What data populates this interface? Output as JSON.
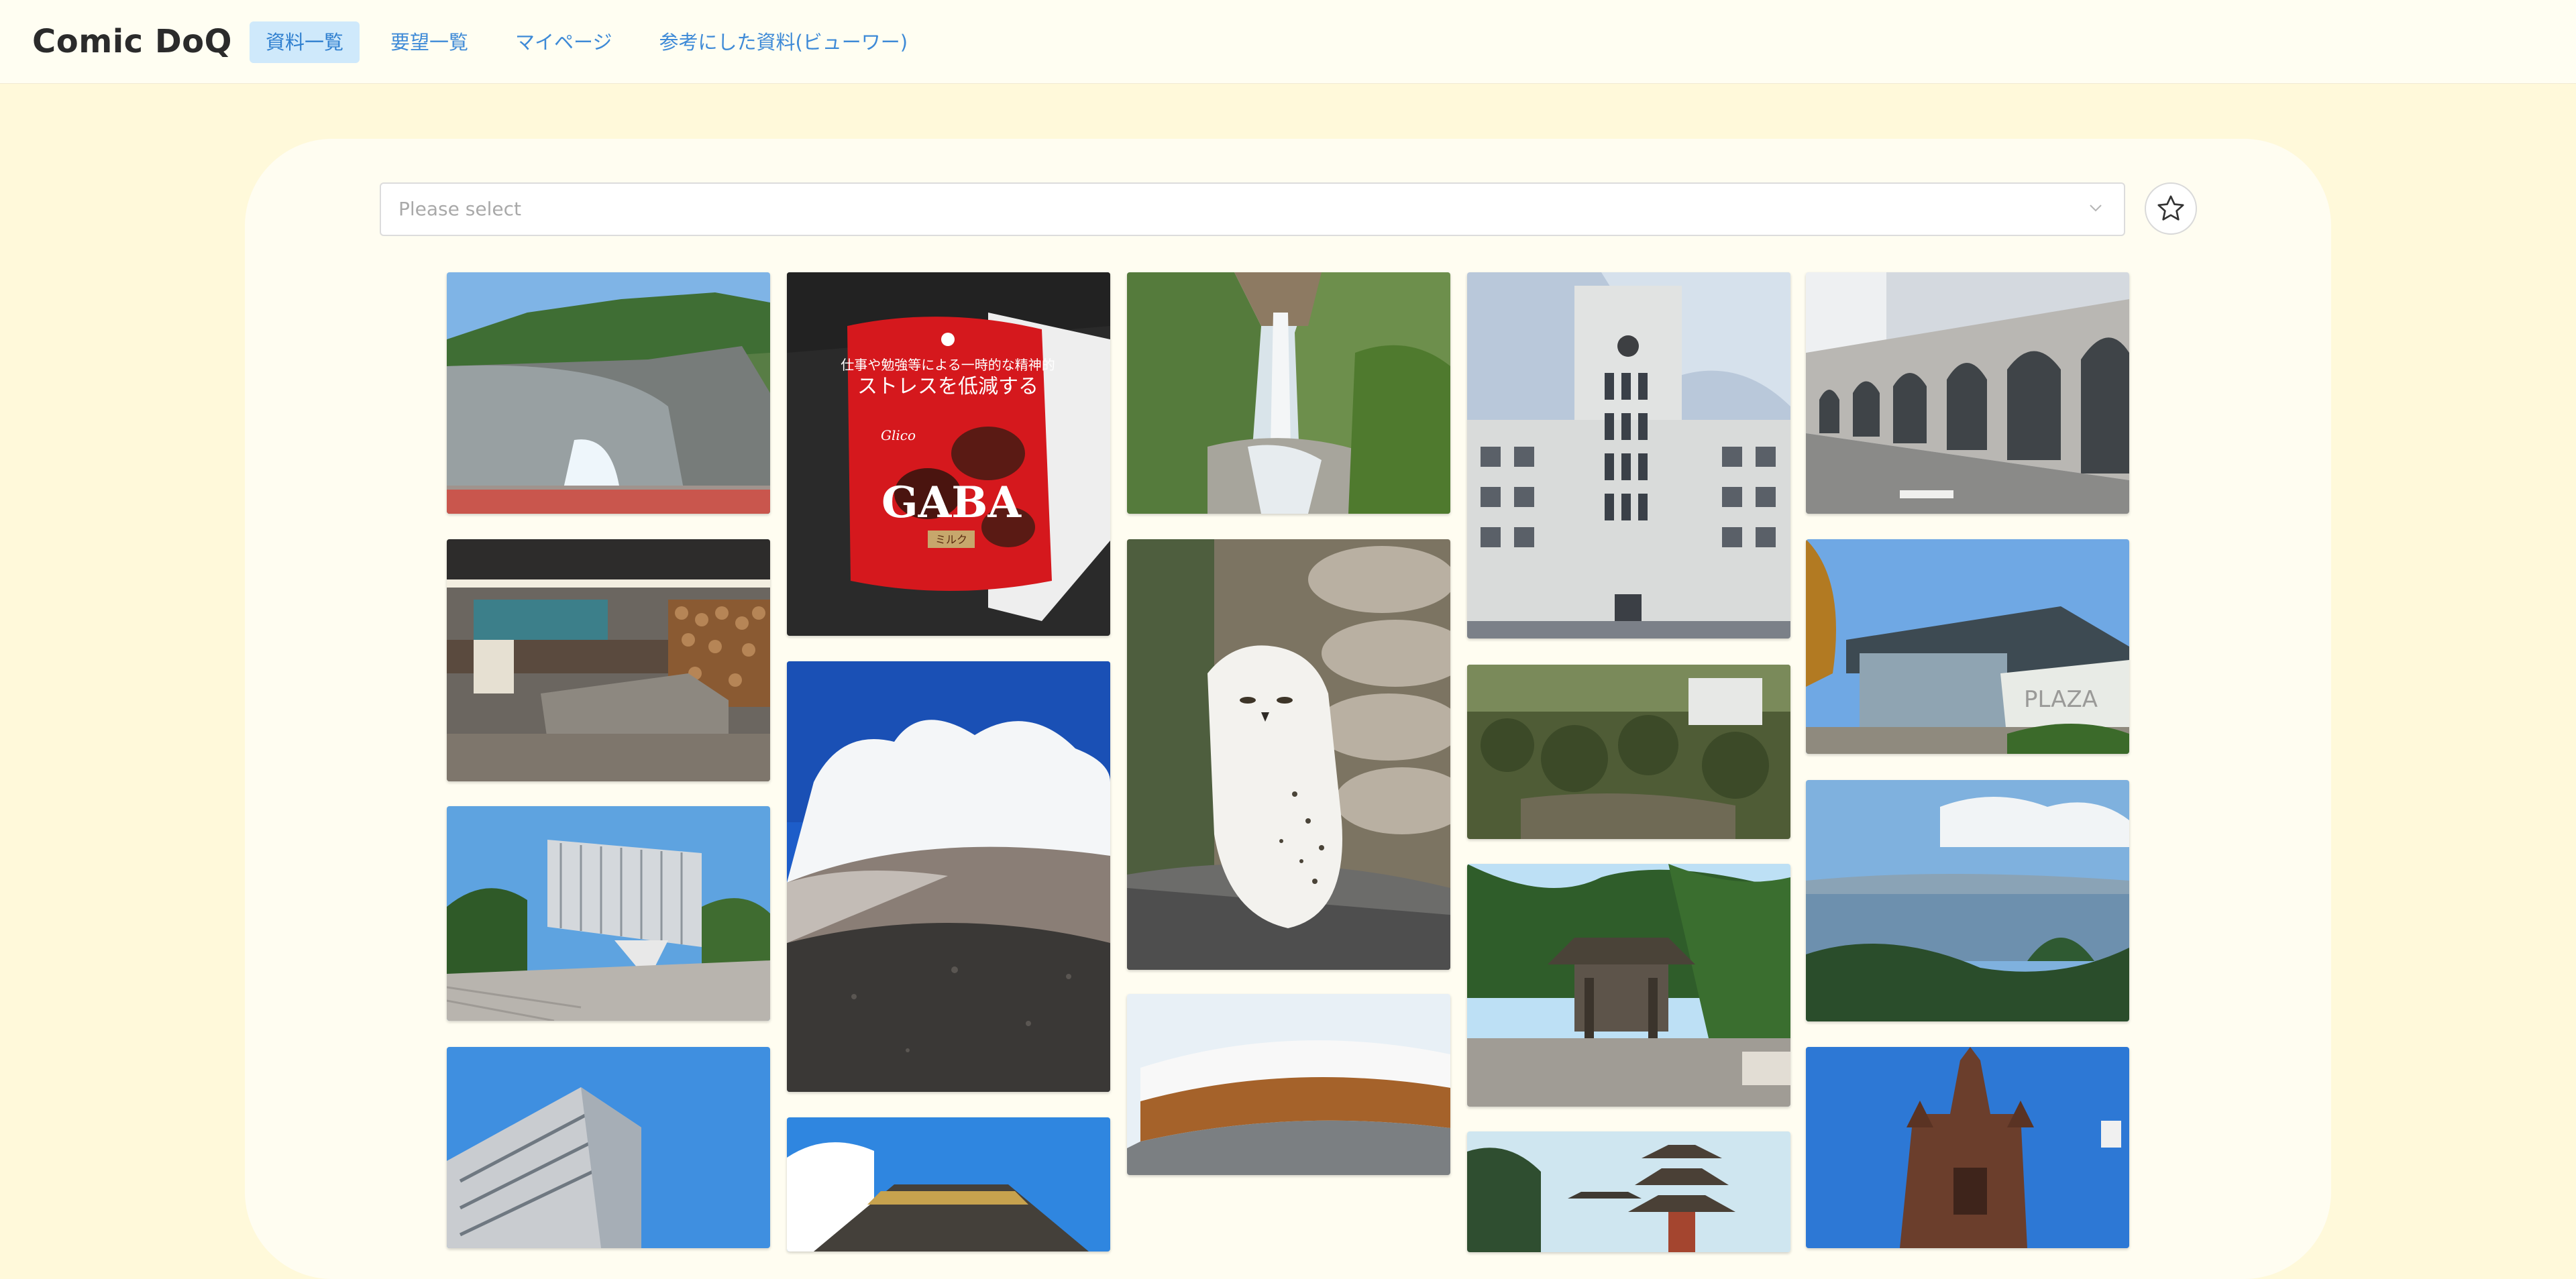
{
  "header": {
    "brand": "Comic DoQ",
    "nav": [
      {
        "label": "資料一覧",
        "active": true
      },
      {
        "label": "要望一覧",
        "active": false
      },
      {
        "label": "マイページ",
        "active": false
      },
      {
        "label": "参考にした資料(ビューワー)",
        "active": false
      }
    ]
  },
  "filter": {
    "placeholder": "Please select",
    "chevron_icon": "chevron-down-icon",
    "favorite_icon": "star-outline-icon"
  },
  "gallery": {
    "photos": [
      {
        "subject": "dam"
      },
      {
        "subject": "chocolate-package"
      },
      {
        "subject": "waterfall"
      },
      {
        "subject": "clock-tower-building"
      },
      {
        "subject": "concrete-arches"
      },
      {
        "subject": "lounge-interior"
      },
      {
        "subject": "volcano-clouds"
      },
      {
        "subject": "snowy-owl"
      },
      {
        "subject": "forest-garden"
      },
      {
        "subject": "modern-glass-building"
      },
      {
        "subject": "glass-office-building"
      },
      {
        "subject": "wood-curved-building"
      },
      {
        "subject": "shrine-pine-trees"
      },
      {
        "subject": "sea-mountain-view"
      },
      {
        "subject": "tower-building"
      },
      {
        "subject": "temple-roof"
      },
      {
        "subject": "pagoda"
      },
      {
        "subject": "gothic-cathedral"
      }
    ],
    "package_text": {
      "tagline": "仕事や勉強等による一時的な精神的",
      "headline": "ストレスを低減する",
      "maker": "Glico",
      "brand": "GABA",
      "flavor": "ミルク"
    },
    "sign_text": "PLAZA"
  }
}
